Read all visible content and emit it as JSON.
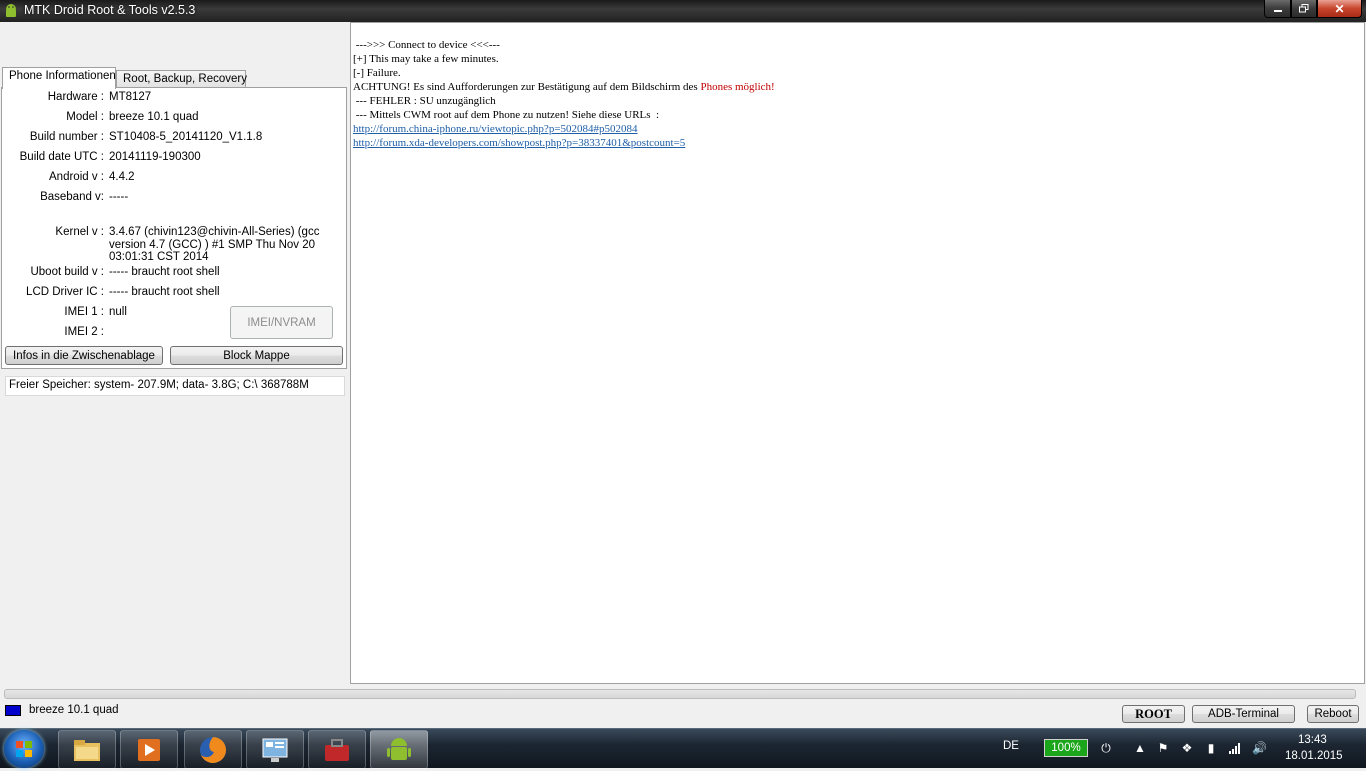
{
  "window": {
    "title": "MTK Droid Root & Tools v2.5.3"
  },
  "tabs": [
    {
      "label": "Phone Informationen",
      "active": true
    },
    {
      "label": "Root, Backup, Recovery",
      "active": false
    }
  ],
  "info": {
    "hardware_label": "Hardware :",
    "hardware": "MT8127",
    "model_label": "Model :",
    "model": "breeze 10.1 quad",
    "build_number_label": "Build number :",
    "build_number": "ST10408-5_20141120_V1.1.8",
    "build_date_label": "Build date UTC :",
    "build_date": "20141119-190300",
    "android_label": "Android  v :",
    "android": "4.4.2",
    "baseband_label": "Baseband v:",
    "baseband": "-----",
    "kernel_label": "Kernel v :",
    "kernel": "3.4.67 (chivin123@chivin-All-Series) (gcc version 4.7 (GCC) ) #1 SMP  Thu Nov 20 03:01:31 CST 2014",
    "uboot_label": "Uboot build v :",
    "uboot": "----- braucht  root shell",
    "lcd_label": "LCD Driver IC :",
    "lcd": "----- braucht  root shell",
    "imei1_label": "IMEI 1 :",
    "imei1": "null",
    "imei2_label": "IMEI 2 :",
    "imei2": ""
  },
  "buttons": {
    "imei_nvram": "IMEI/NVRAM",
    "copy_info": "Infos in die Zwischenablage",
    "block_map": "Block Mappe",
    "root": "ROOT",
    "adb_terminal": "ADB-Terminal",
    "reboot": "Reboot"
  },
  "free_memory": "Freier Speicher: system- 207.9M; data- 3.8G;  C:\\ 368788M",
  "log": {
    "line1": " --->>> Connect to device <<<---",
    "line2": "[+] This may take a few minutes.",
    "line3": "[-] Failure.",
    "line4a": "ACHTUNG! Es sind Aufforderungen zur Bestätigung auf dem Bildschirm des ",
    "line4b": "Phones möglich!",
    "line5": " --- FEHLER : SU unzugänglich",
    "line6": " --- Mittels CWM root auf dem Phone zu nutzen! Siehe diese URLs  :",
    "link1": "http://forum.china-iphone.ru/viewtopic.php?p=502084#p502084",
    "link2": "http://forum.xda-developers.com/showpost.php?p=38337401&postcount=5"
  },
  "status": {
    "device_name": "breeze 10.1 quad",
    "device_color": "#0000cc"
  },
  "taskbar": {
    "language": "DE",
    "battery": "100%",
    "time": "13:43",
    "date": "18.01.2015"
  }
}
